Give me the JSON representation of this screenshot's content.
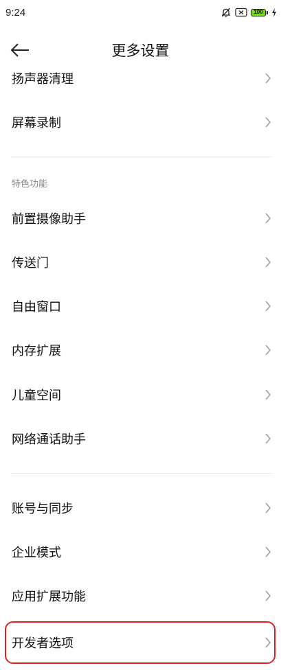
{
  "status_bar": {
    "time": "9:24",
    "battery_level": "100",
    "icons": [
      "mute-bell-icon",
      "sim-x-icon",
      "battery-icon",
      "charging-icon"
    ],
    "battery_color": "#7ed321"
  },
  "header": {
    "title": "更多设置",
    "back_icon": "back-arrow-icon"
  },
  "items_top": [
    {
      "label": "扬声器清理"
    },
    {
      "label": "屏幕录制"
    }
  ],
  "section_features": {
    "title": "特色功能",
    "items": [
      {
        "label": "前置摄像助手"
      },
      {
        "label": "传送门"
      },
      {
        "label": "自由窗口"
      },
      {
        "label": "内存扩展"
      },
      {
        "label": "儿童空间"
      },
      {
        "label": "网络通话助手"
      }
    ]
  },
  "items_bottom": [
    {
      "label": "账号与同步"
    },
    {
      "label": "企业模式"
    },
    {
      "label": "应用扩展功能"
    },
    {
      "label": "开发者选项",
      "highlighted": true
    }
  ],
  "colors": {
    "highlight": "#e02020",
    "section_title": "#8a8a8a",
    "chevron": "#9a9a9a"
  }
}
